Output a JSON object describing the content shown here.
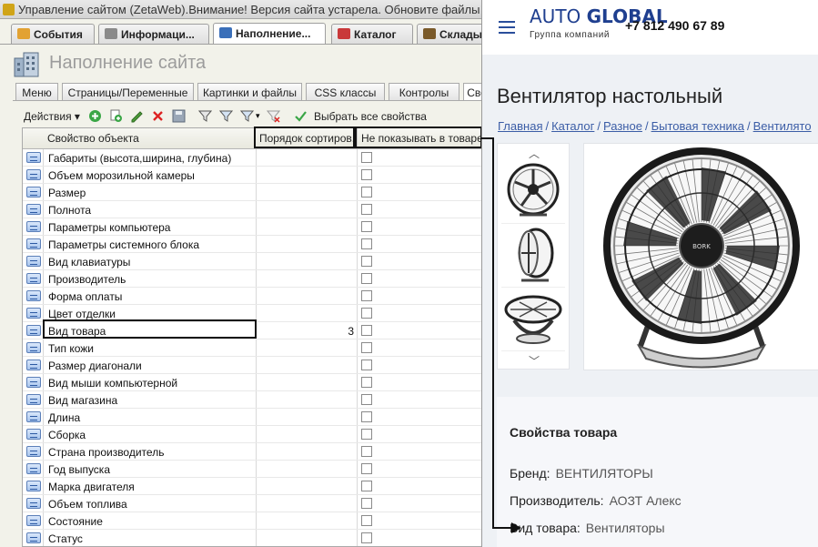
{
  "admin": {
    "window_title": "Управление сайтом (ZetaWeb).Внимание! Версия сайта устарела. Обновите файлы с",
    "window_tabs": [
      "События",
      "Информаци...",
      "Наполнение...",
      "Каталог",
      "Склады"
    ],
    "page_title": "Наполнение сайта",
    "inner_tabs": [
      "Меню",
      "Страницы/Переменные",
      "Картинки и файлы",
      "CSS классы",
      "Контролы",
      "Сво"
    ],
    "toolbar": {
      "actions": "Действия",
      "select_all": "Выбрать все свойства"
    },
    "columns": [
      "Свойство объекта",
      "Порядок сортиров...",
      "Не показывать в товаре"
    ],
    "rows": [
      {
        "name": "Габариты (высота,ширина, глубина)",
        "order": ""
      },
      {
        "name": "Объем морозильной камеры",
        "order": ""
      },
      {
        "name": "Размер",
        "order": ""
      },
      {
        "name": "Полнота",
        "order": ""
      },
      {
        "name": "Параметры компьютера",
        "order": ""
      },
      {
        "name": "Параметры системного блока",
        "order": ""
      },
      {
        "name": "Вид клавиатуры",
        "order": ""
      },
      {
        "name": "Производитель",
        "order": ""
      },
      {
        "name": "Форма оплаты",
        "order": ""
      },
      {
        "name": "Цвет отделки",
        "order": ""
      },
      {
        "name": "Вид товара",
        "order": "3"
      },
      {
        "name": "Тип кожи",
        "order": ""
      },
      {
        "name": "Размер диагонали",
        "order": ""
      },
      {
        "name": "Вид мыши компьютерной",
        "order": ""
      },
      {
        "name": "Вид магазина",
        "order": ""
      },
      {
        "name": "Длина",
        "order": ""
      },
      {
        "name": "Сборка",
        "order": ""
      },
      {
        "name": "Страна производитель",
        "order": ""
      },
      {
        "name": "Год выпуска",
        "order": ""
      },
      {
        "name": "Марка двигателя",
        "order": ""
      },
      {
        "name": "Объем топлива",
        "order": ""
      },
      {
        "name": "Состояние",
        "order": ""
      },
      {
        "name": "Статус",
        "order": ""
      }
    ]
  },
  "site": {
    "logo_auto": "AUTO",
    "logo_global": "GLOBAL",
    "logo_sub": "Группа компаний",
    "phone": "+7 812 490 67 89",
    "product_title": "Вентилятор настольный",
    "breadcrumbs": [
      "Главная",
      "Каталог",
      "Разное",
      "Бытовая техника",
      "Вентилято"
    ],
    "fan_brand": "BORK",
    "props_title": "Свойства товара",
    "props": [
      {
        "key": "Бренд:",
        "value": "ВЕНТИЛЯТОРЫ"
      },
      {
        "key": "Производитель:",
        "value": "АОЗТ Алекс"
      },
      {
        "key": "Вид товара:",
        "value": "Вентиляторы"
      }
    ]
  },
  "colors": {
    "site_accent": "#1f3f8f",
    "link": "#3b5da6",
    "admin_bg": "#f2f2ea"
  }
}
